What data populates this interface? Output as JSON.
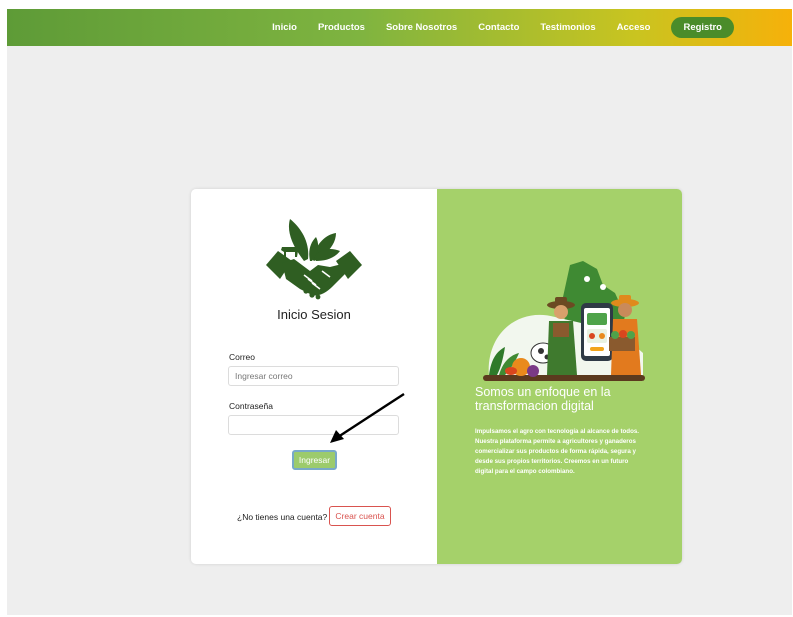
{
  "nav": {
    "items": [
      "Inicio",
      "Productos",
      "Sobre Nosotros",
      "Contacto",
      "Testimonios",
      "Acceso"
    ],
    "register_label": "Registro"
  },
  "login": {
    "title": "Inicio Sesion",
    "email_label": "Correo",
    "email_placeholder": "Ingresar correo",
    "password_label": "Contraseña",
    "submit_label": "Ingresar",
    "no_account_text": "¿No tienes una cuenta?",
    "create_account_label": "Crear cuenta"
  },
  "promo": {
    "title": "Somos un enfoque en la transformacion digital",
    "text": "Impulsamos el agro con tecnología al alcance de todos. Nuestra plataforma permite a agricultores y ganaderos comercializar sus productos de forma rápida, segura y desde sus propios territorios. Creemos en un futuro digital para el campo colombiano."
  },
  "colors": {
    "brand_green": "#2f5e22",
    "panel_green": "#a5d16a",
    "register_button": "#4a8c2a",
    "create_account": "#d9534f"
  },
  "icons": {
    "logo": "handshake-plant-cow-icon",
    "annotation": "arrow-icon"
  }
}
